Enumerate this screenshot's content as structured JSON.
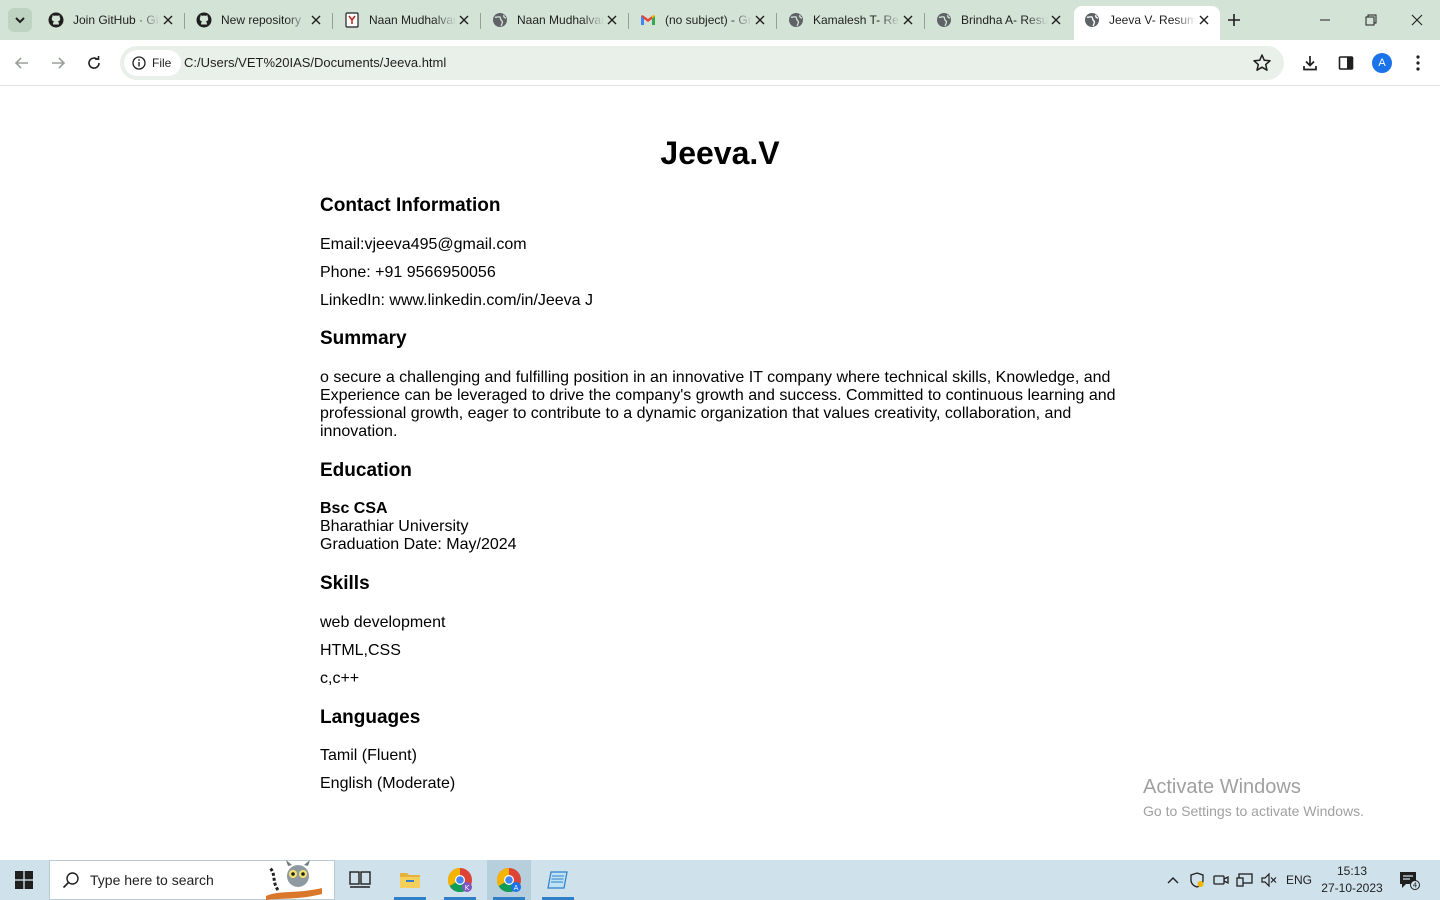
{
  "browser": {
    "tabs": [
      {
        "title": "Join GitHub · GitHub",
        "icon": "github-icon"
      },
      {
        "title": "New repository",
        "icon": "github-icon"
      },
      {
        "title": "Naan Mudhalvan",
        "icon": "naan-mudhalvan-icon"
      },
      {
        "title": "Naan Mudhalvan",
        "icon": "globe-icon"
      },
      {
        "title": "(no subject) - Gmail",
        "icon": "gmail-icon"
      },
      {
        "title": "Kamalesh T- Resume",
        "icon": "globe-icon"
      },
      {
        "title": "Brindha A- Resume",
        "icon": "globe-icon"
      },
      {
        "title": "Jeeva V- Resume",
        "icon": "globe-icon",
        "active": true
      }
    ],
    "chip_label": "File",
    "url": "C:/Users/VET%20IAS/Documents/Jeeva.html",
    "avatar_letter": "A",
    "accent_color": "#1a73e8",
    "tabstrip_color": "#d3e3d5"
  },
  "resume": {
    "name": "Jeeva.V",
    "contact": {
      "heading": "Contact Information",
      "email": "Email:vjeeva495@gmail.com",
      "phone": "Phone: +91 9566950056",
      "linkedin": "LinkedIn: www.linkedin.com/in/Jeeva J"
    },
    "summary": {
      "heading": "Summary",
      "text": "o secure a challenging and fulfilling position in an innovative IT company where technical skills, Knowledge, and Experience can be leveraged to drive the company's growth and success. Committed to continuous learning and professional growth, eager to contribute to a dynamic organization that values creativity, collaboration, and innovation."
    },
    "education": {
      "heading": "Education",
      "degree": "Bsc CSA",
      "university": "Bharathiar University",
      "graduation": "Graduation Date: May/2024"
    },
    "skills": {
      "heading": "Skills",
      "items": [
        "web development",
        "HTML,CSS",
        "c,c++"
      ]
    },
    "languages": {
      "heading": "Languages",
      "items": [
        "Tamil (Fluent)",
        "English (Moderate)"
      ]
    }
  },
  "watermark": {
    "line1": "Activate Windows",
    "line2": "Go to Settings to activate Windows."
  },
  "taskbar": {
    "search_placeholder": "Type here to search",
    "language": "ENG",
    "time": "15:13",
    "date": "27-10-2023",
    "notification_count": "4"
  }
}
